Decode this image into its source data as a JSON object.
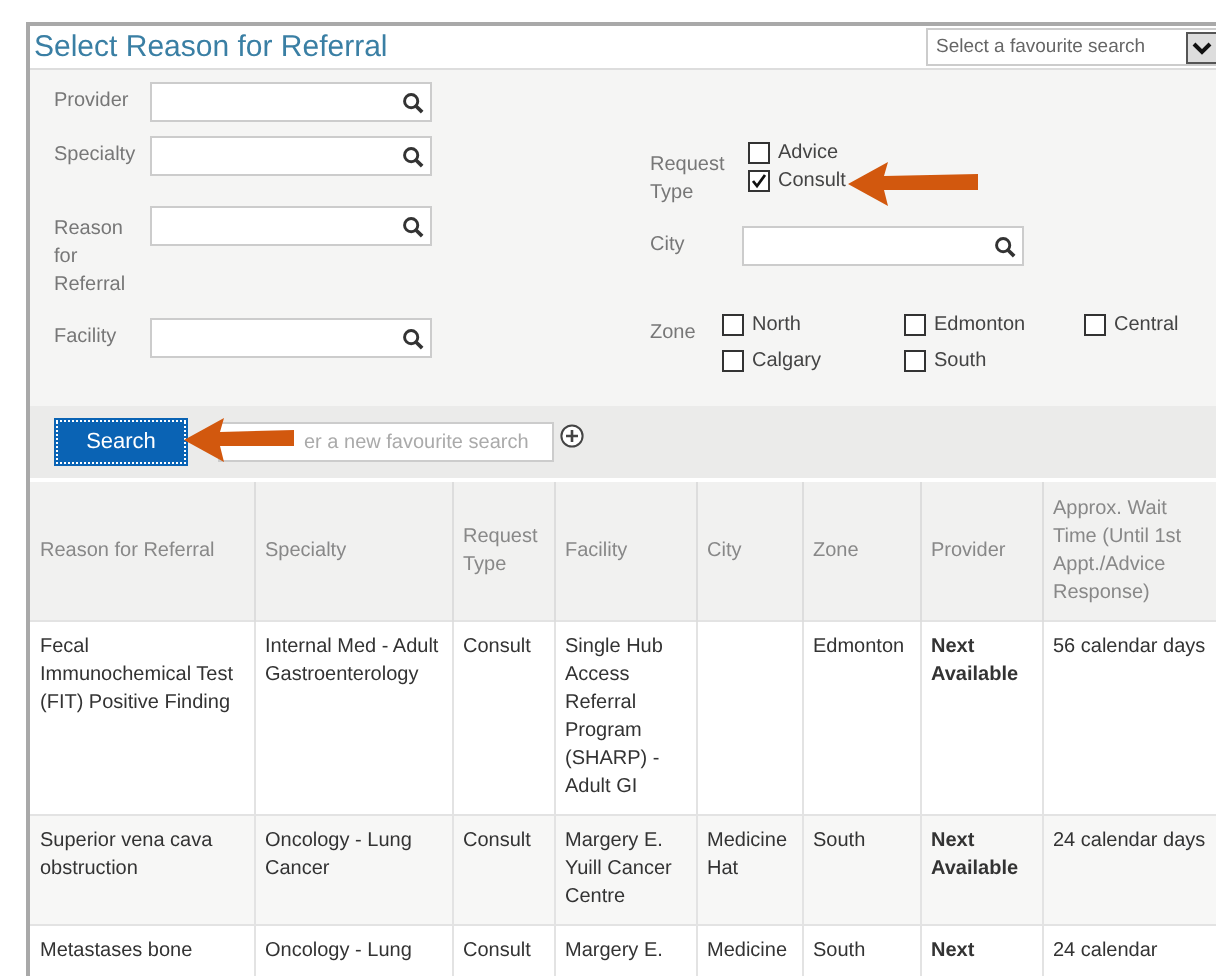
{
  "title": "Select Reason for Referral",
  "favourite_select": {
    "value": "Select a favourite search"
  },
  "left_fields": [
    {
      "label": "Provider"
    },
    {
      "label": "Specialty"
    },
    {
      "label": "Reason for Referral"
    },
    {
      "label": "Facility"
    }
  ],
  "request_type": {
    "label": "Request Type",
    "options": [
      {
        "label": "Advice",
        "checked": false
      },
      {
        "label": "Consult",
        "checked": true
      }
    ]
  },
  "city": {
    "label": "City"
  },
  "zone": {
    "label": "Zone",
    "options": [
      {
        "label": "North",
        "checked": false
      },
      {
        "label": "Edmonton",
        "checked": false
      },
      {
        "label": "Central",
        "checked": false
      },
      {
        "label": "Calgary",
        "checked": false
      },
      {
        "label": "South",
        "checked": false
      }
    ]
  },
  "search_button": "Search",
  "favourite_input": {
    "placeholder": "er a new favourite search"
  },
  "table": {
    "columns": [
      "Reason for Referral",
      "Specialty",
      "Request Type",
      "Facility",
      "City",
      "Zone",
      "Provider",
      "Approx. Wait Time (Until 1st Appt./Advice Response)"
    ],
    "rows": [
      [
        "Fecal Immunochemical Test (FIT) Positive Finding",
        "Internal Med - Adult Gastroenterology",
        "Consult",
        "Single Hub Access Referral Program (SHARP) - Adult GI",
        "",
        "Edmonton",
        "Next Available",
        "56 calendar days"
      ],
      [
        "Superior vena cava obstruction",
        "Oncology - Lung Cancer",
        "Consult",
        "Margery E. Yuill Cancer Centre",
        "Medicine Hat",
        "South",
        "Next Available",
        "24 calendar days"
      ],
      [
        "Metastases bone",
        "Oncology - Lung",
        "Consult",
        "Margery E.",
        "Medicine",
        "South",
        "Next",
        "24 calendar"
      ]
    ]
  }
}
